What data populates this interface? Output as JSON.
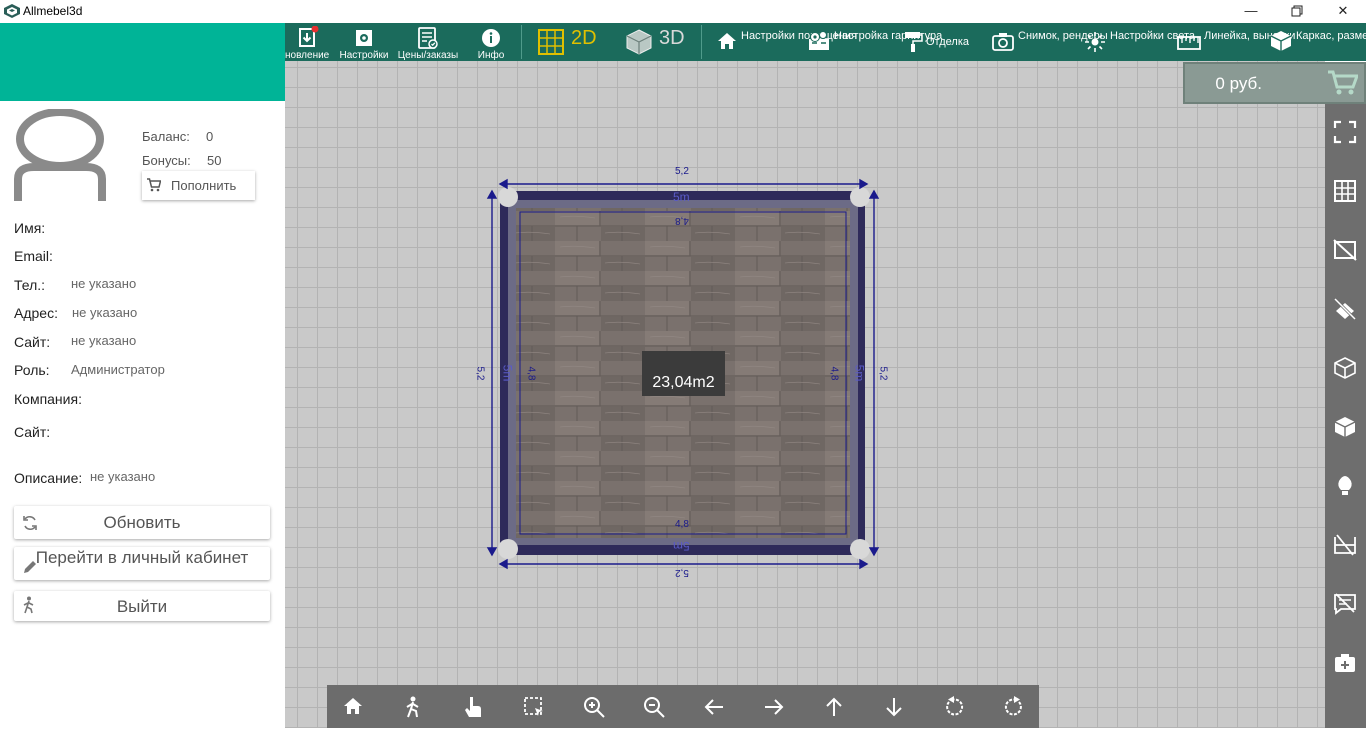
{
  "window": {
    "title": "Allmebel3d"
  },
  "toolbar": {
    "items": [
      {
        "label": "новление",
        "icon": "save-download-icon"
      },
      {
        "label": "Настройки",
        "icon": "settings-icon"
      },
      {
        "label": "Цены/заказы",
        "icon": "price-list-icon"
      },
      {
        "label": "Инфо",
        "icon": "info-icon"
      }
    ],
    "mode_2d": "2D",
    "mode_3d": "3D",
    "room_settings": "Настройки помещения",
    "furniture_settings": "Настройка гарнитура",
    "finishing": "Отделка",
    "snapshot": "Снимок, рендеры",
    "light_settings": "Настройки света",
    "ruler": "Линейка, выноски",
    "frame": "Каркас, размеры"
  },
  "price": {
    "value": "0 руб."
  },
  "profile": {
    "balance_label": "Баланс:",
    "balance_value": "0",
    "bonus_label": "Бонусы:",
    "bonus_value": "50",
    "topup_label": "Пополнить",
    "name_label": "Имя:",
    "email_label": "Email:",
    "phone_label": "Тел.:",
    "phone_value": "не указано",
    "address_label": "Адрес:",
    "address_value": "не указано",
    "site_label": "Сайт:",
    "site_value": "не указано",
    "role_label": "Роль:",
    "role_value": "Администратор",
    "company_label": "Компания:",
    "company_site_label": "Сайт:",
    "description_label": "Описание:",
    "description_value": "не указано"
  },
  "actions": {
    "refresh": "Обновить",
    "cabinet": "Перейти в личный кабинет",
    "logout": "Выйти"
  },
  "room": {
    "area": "23,04m2",
    "outer_dim": "5,2",
    "wall_dim": "5m",
    "inner_dim": "4,8"
  },
  "colors": {
    "toolbar": "#1b6b5c",
    "header": "#00b497",
    "accent_2d": "#e0c000",
    "wall": "#2e2a5a",
    "dimension": "#1a1a8c"
  }
}
